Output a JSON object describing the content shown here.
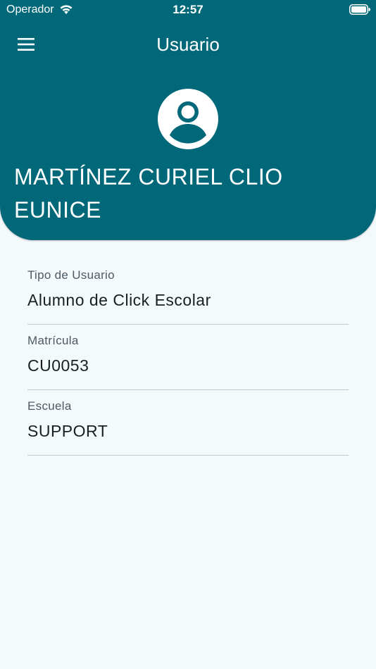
{
  "status_bar": {
    "carrier": "Operador",
    "time": "12:57",
    "wifi_icon": "wifi-icon",
    "battery_icon": "battery-icon"
  },
  "app_bar": {
    "title": "Usuario",
    "menu_icon": "hamburger-menu-icon",
    "background_color": "#006878"
  },
  "profile": {
    "avatar_icon": "account-circle-icon",
    "name": "MARTÍNEZ CURIEL CLIO EUNICE"
  },
  "fields": [
    {
      "label": "Tipo de Usuario",
      "value": "Alumno de Click Escolar"
    },
    {
      "label": "Matrícula",
      "value": "CU0053"
    },
    {
      "label": "Escuela",
      "value": "SUPPORT"
    }
  ]
}
